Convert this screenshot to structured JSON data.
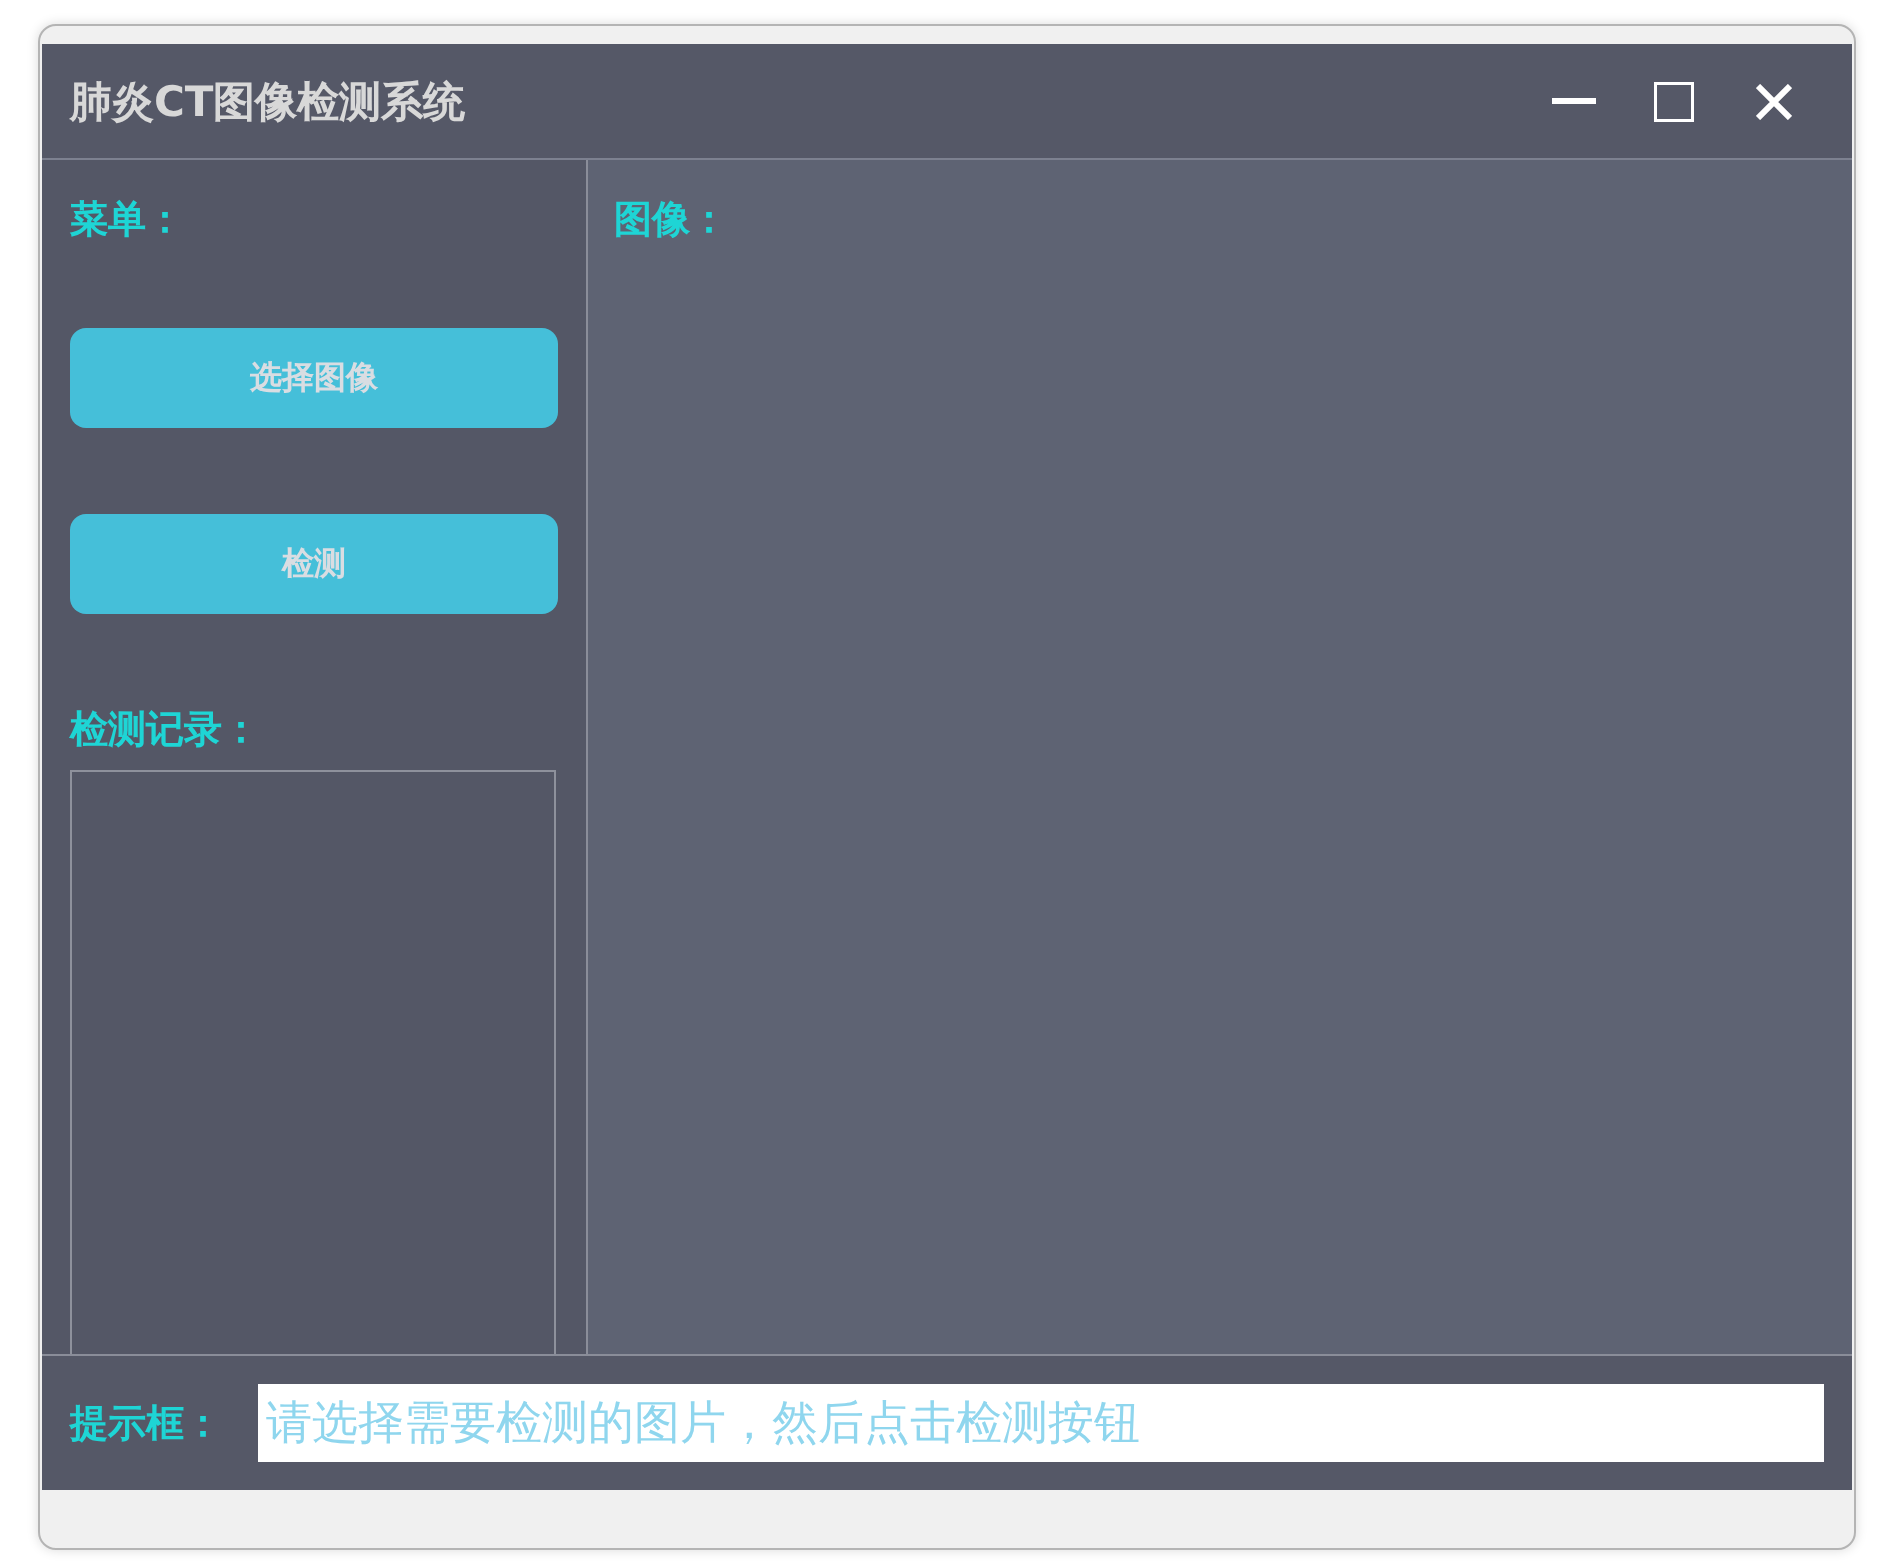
{
  "window": {
    "title": "肺炎CT图像检测系统"
  },
  "menu": {
    "label": "菜单：",
    "buttons": [
      "选择图像",
      "检测"
    ]
  },
  "history": {
    "label": "检测记录："
  },
  "image": {
    "label": "图像："
  },
  "prompt": {
    "label": "提示框：",
    "value": "请选择需要检测的图片，然后点击检测按钮"
  }
}
